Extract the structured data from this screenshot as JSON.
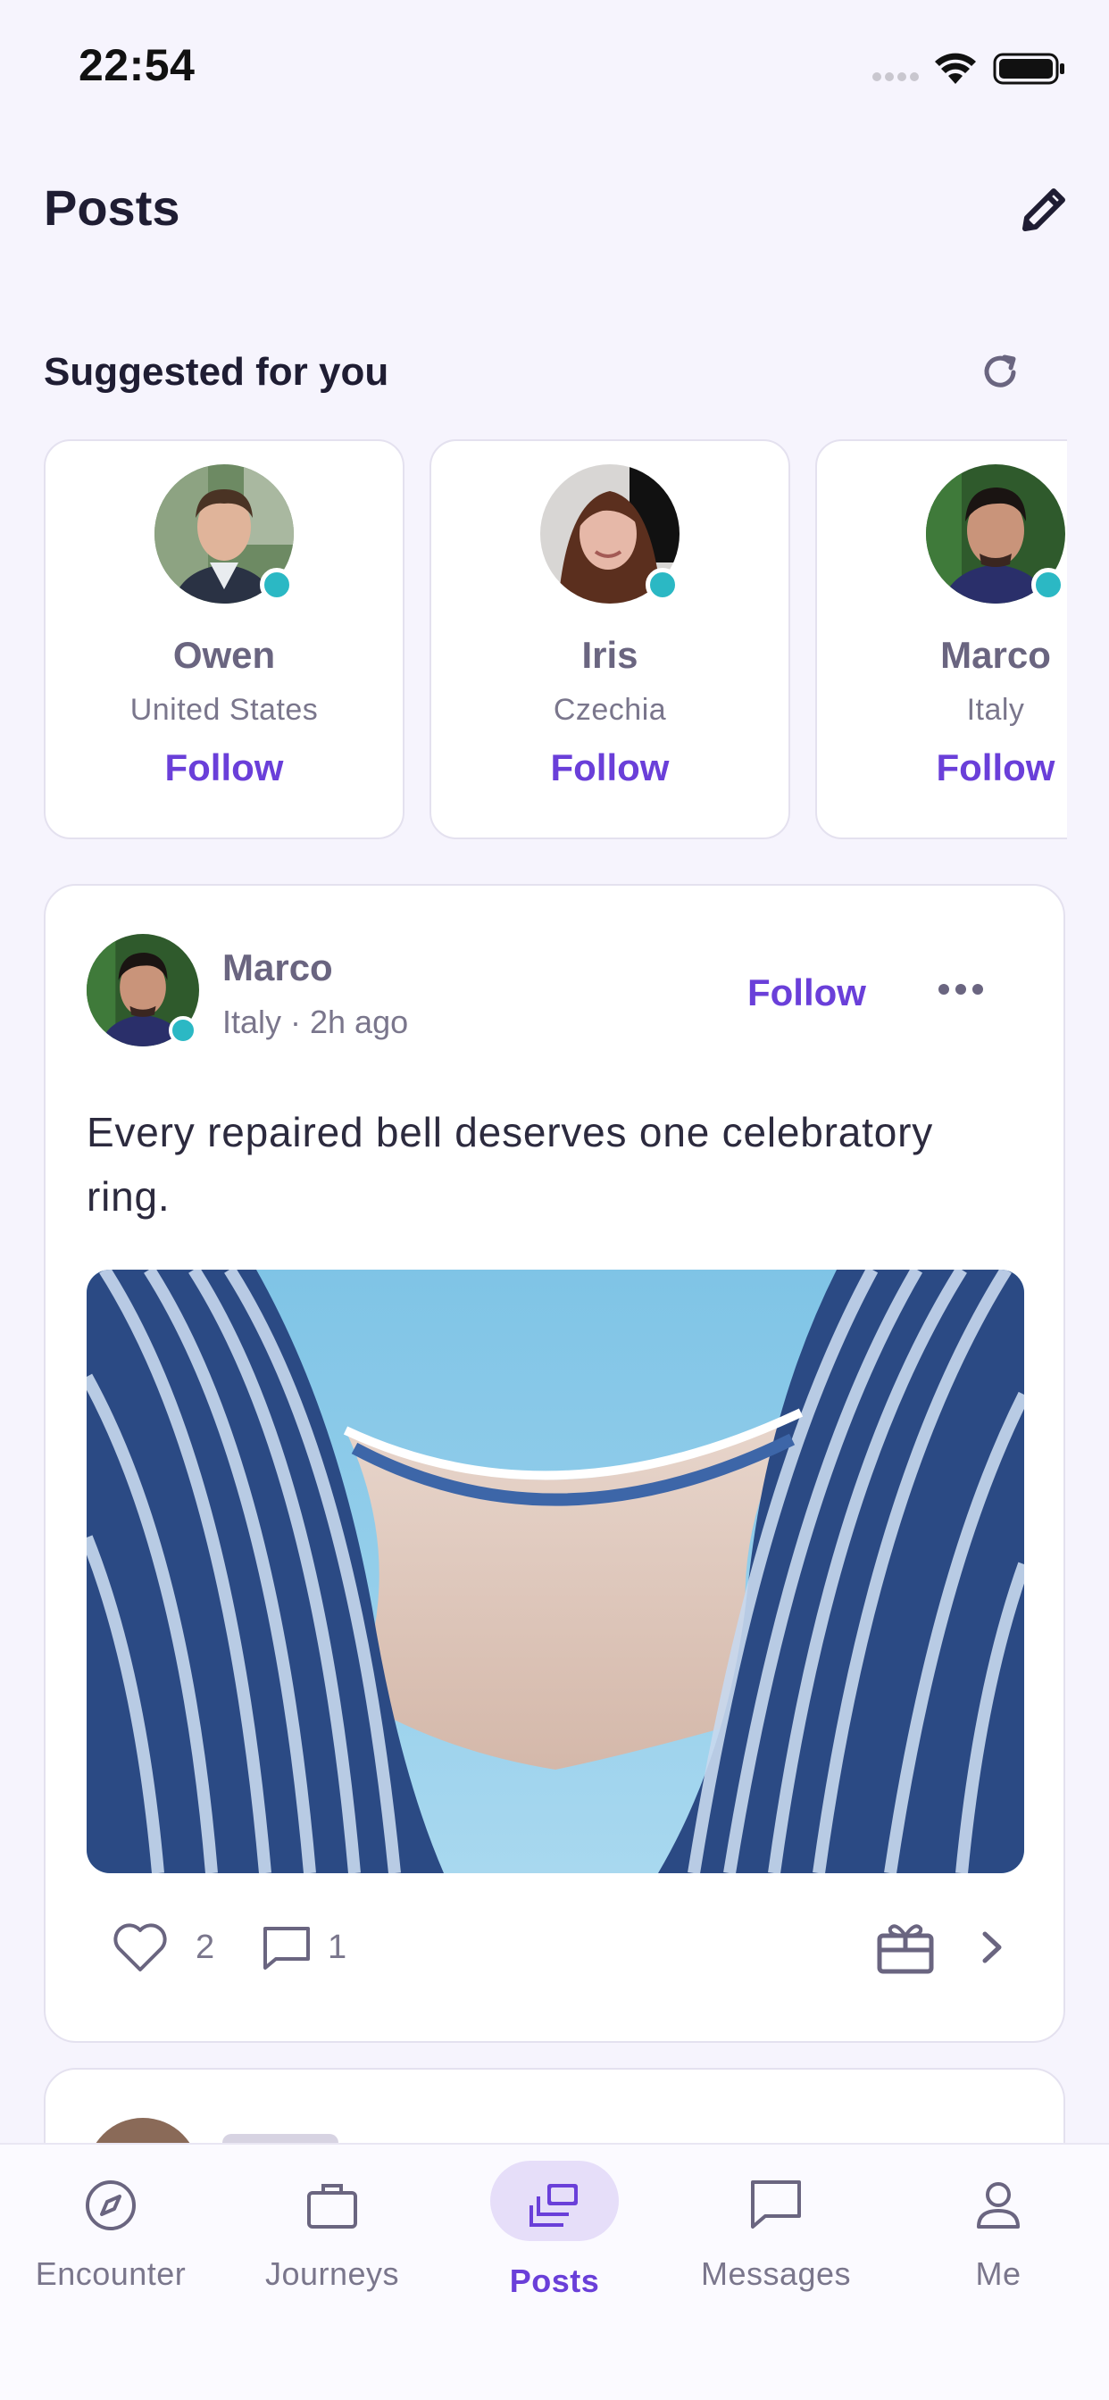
{
  "status_bar": {
    "time": "22:54"
  },
  "header": {
    "title": "Posts"
  },
  "suggested": {
    "title": "Suggested for you",
    "users": [
      {
        "name": "Owen",
        "country": "United States",
        "follow_label": "Follow"
      },
      {
        "name": "Iris",
        "country": "Czechia",
        "follow_label": "Follow"
      },
      {
        "name": "Marco",
        "country": "Italy",
        "follow_label": "Follow"
      }
    ]
  },
  "post": {
    "author": "Marco",
    "meta": "Italy · 2h ago",
    "follow_label": "Follow",
    "text": "Every repaired bell deserves one celebratory ring.",
    "likes": "2",
    "comments": "1"
  },
  "nav": {
    "items": [
      {
        "label": "Encounter",
        "icon": "compass-icon"
      },
      {
        "label": "Journeys",
        "icon": "briefcase-icon"
      },
      {
        "label": "Posts",
        "icon": "stacked-cards-icon",
        "active": true
      },
      {
        "label": "Messages",
        "icon": "chat-bubble-icon"
      },
      {
        "label": "Me",
        "icon": "person-icon"
      }
    ]
  },
  "colors": {
    "accent": "#6a3fd9",
    "online": "#2bb8c4",
    "background": "#f6f4fd"
  }
}
